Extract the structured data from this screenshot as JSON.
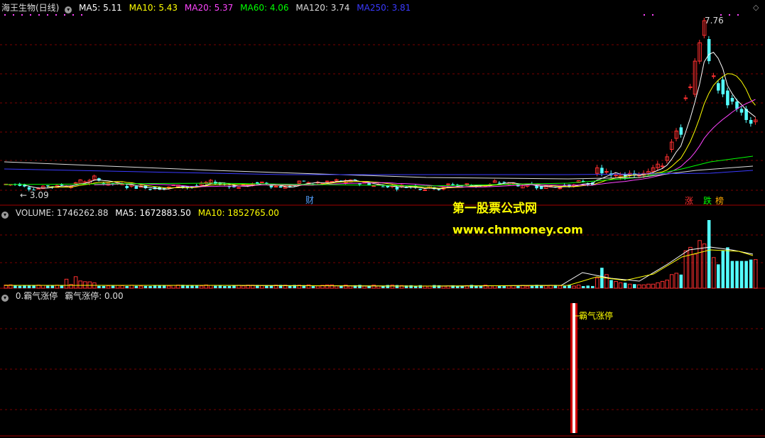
{
  "price_header": {
    "stock_name": "海王生物(日线)",
    "ma_items": [
      {
        "text": "MA5: 5.11",
        "color": "#ffffff"
      },
      {
        "text": "MA10: 5.43",
        "color": "#ffff00"
      },
      {
        "text": "MA20: 5.37",
        "color": "#ff44ff"
      },
      {
        "text": "MA60: 4.06",
        "color": "#00ff00"
      },
      {
        "text": "MA120: 3.74",
        "color": "#dddddd"
      },
      {
        "text": "MA250: 3.81",
        "color": "#3a3aff"
      }
    ]
  },
  "price_labels": {
    "high_label": "7.76",
    "low_label": "← 3.09",
    "event_cai": "财",
    "event_zhang": "涨",
    "event_die": "跌",
    "event_bang": "榜"
  },
  "volume_header": {
    "items": [
      {
        "text": "VOLUME: 1746262.88",
        "color": "#dddddd"
      },
      {
        "text": "MA5: 1672883.50",
        "color": "#ffffff"
      },
      {
        "text": "MA10: 1852765.00",
        "color": "#ffff00"
      }
    ]
  },
  "indicator_header": {
    "items": [
      {
        "text": "0.霸气涨停",
        "color": "#dddddd"
      },
      {
        "text": "霸气涨停: 0.00",
        "color": "#dddddd"
      }
    ],
    "signal_label": "霸气涨停"
  },
  "watermark": {
    "title": "第一股票公式网",
    "url": "www.chnmoney.com"
  },
  "colors": {
    "up": "#ff3030",
    "down": "#54ffff",
    "grid": "#7a0000",
    "signal": "#ffffff",
    "signal_edge": "#cc0000"
  }
}
